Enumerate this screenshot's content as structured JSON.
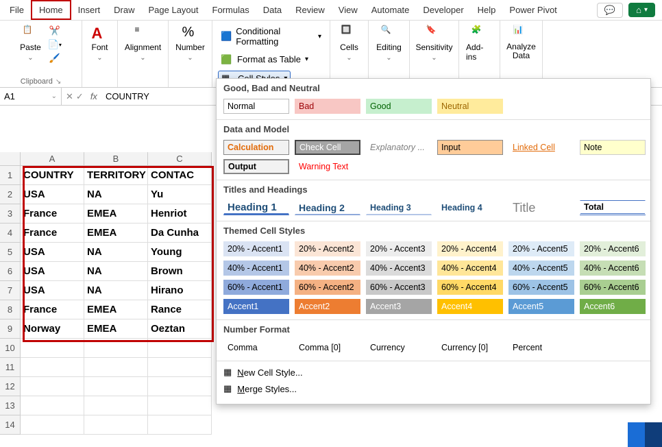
{
  "tabs": [
    "File",
    "Home",
    "Insert",
    "Draw",
    "Page Layout",
    "Formulas",
    "Data",
    "Review",
    "View",
    "Automate",
    "Developer",
    "Help",
    "Power Pivot"
  ],
  "active_tab": "Home",
  "ribbon": {
    "clipboard": {
      "paste": "Paste",
      "label": "Clipboard"
    },
    "font": {
      "label": "Font"
    },
    "alignment": {
      "label": "Alignment"
    },
    "number": {
      "label": "Number"
    },
    "styles": {
      "conditional": "Conditional Formatting",
      "as_table": "Format as Table",
      "cell_styles": "Cell Styles"
    },
    "cells": "Cells",
    "editing": "Editing",
    "sensitivity": "Sensitivity",
    "addins": "Add-ins",
    "analyze": "Analyze Data"
  },
  "formula_bar": {
    "name": "A1",
    "value": "COUNTRY"
  },
  "columns": [
    "A",
    "B",
    "C"
  ],
  "rows": [
    "1",
    "2",
    "3",
    "4",
    "5",
    "6",
    "7",
    "8",
    "9",
    "10",
    "11",
    "12",
    "13",
    "14"
  ],
  "cells": {
    "r0": [
      "COUNTRY",
      "TERRITORY",
      "CONTAC"
    ],
    "r1": [
      "USA",
      "NA",
      "Yu"
    ],
    "r2": [
      "France",
      "EMEA",
      "Henriot"
    ],
    "r3": [
      "France",
      "EMEA",
      "Da Cunha"
    ],
    "r4": [
      "USA",
      "NA",
      "Young"
    ],
    "r5": [
      "USA",
      "NA",
      "Brown"
    ],
    "r6": [
      "USA",
      "NA",
      "Hirano"
    ],
    "r7": [
      "France",
      "EMEA",
      "Rance"
    ],
    "r8": [
      "Norway",
      "EMEA",
      "Oeztan"
    ]
  },
  "dropdown": {
    "tooltip": "Output",
    "sec1": "Good, Bad and Neutral",
    "gbn": [
      "Normal",
      "Bad",
      "Good",
      "Neutral"
    ],
    "sec2": "Data and Model",
    "dam": [
      "Calculation",
      "Check Cell",
      "Explanatory ...",
      "Input",
      "Linked Cell",
      "Note",
      "Output",
      "Warning Text"
    ],
    "sec3": "Titles and Headings",
    "th": [
      "Heading 1",
      "Heading 2",
      "Heading 3",
      "Heading 4",
      "Title",
      "Total"
    ],
    "sec4": "Themed Cell Styles",
    "themed": {
      "r20": [
        "20% - Accent1",
        "20% - Accent2",
        "20% - Accent3",
        "20% - Accent4",
        "20% - Accent5",
        "20% - Accent6"
      ],
      "r40": [
        "40% - Accent1",
        "40% - Accent2",
        "40% - Accent3",
        "40% - Accent4",
        "40% - Accent5",
        "40% - Accent6"
      ],
      "r60": [
        "60% - Accent1",
        "60% - Accent2",
        "60% - Accent3",
        "60% - Accent4",
        "60% - Accent5",
        "60% - Accent6"
      ],
      "acc": [
        "Accent1",
        "Accent2",
        "Accent3",
        "Accent4",
        "Accent5",
        "Accent6"
      ]
    },
    "sec5": "Number Format",
    "nf": [
      "Comma",
      "Comma [0]",
      "Currency",
      "Currency [0]",
      "Percent"
    ],
    "new_style": "New Cell Style...",
    "merge": "Merge Styles..."
  }
}
